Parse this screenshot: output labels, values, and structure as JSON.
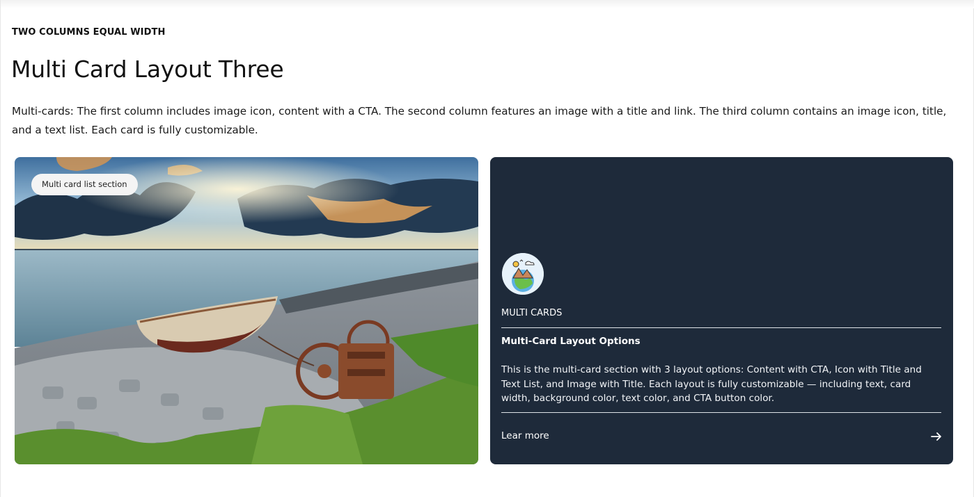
{
  "header": {
    "eyebrow": "TWO COLUMNS EQUAL WIDTH",
    "title": "Multi Card Layout Three",
    "description": "Multi-cards: The first column includes image icon, content with a CTA. The second column features an image with a title and link. The third column contains an image icon, title, and a text list. Each card is fully customizable."
  },
  "image_card": {
    "tag": "Multi card list section",
    "image": "landscape-photo: old rowing boat and rusty winch on a stone shore by the sea at sunset"
  },
  "text_card": {
    "icon": "globe-landscape-icon",
    "kicker": "MULTI CARDS",
    "title": "Multi-Card Layout Options",
    "body": "This is the multi-card section with 3 layout options: Content with CTA, Icon with Title and Text List, and Image with Title. Each layout is fully customizable — including text, card width, background color, text color, and CTA button color.",
    "cta_label": "Lear more",
    "cta_icon": "arrow-right-icon"
  },
  "colors": {
    "dark_card_bg": "#1e2a3a",
    "text": "#111111",
    "pill_bg": "#f4f4f4"
  }
}
